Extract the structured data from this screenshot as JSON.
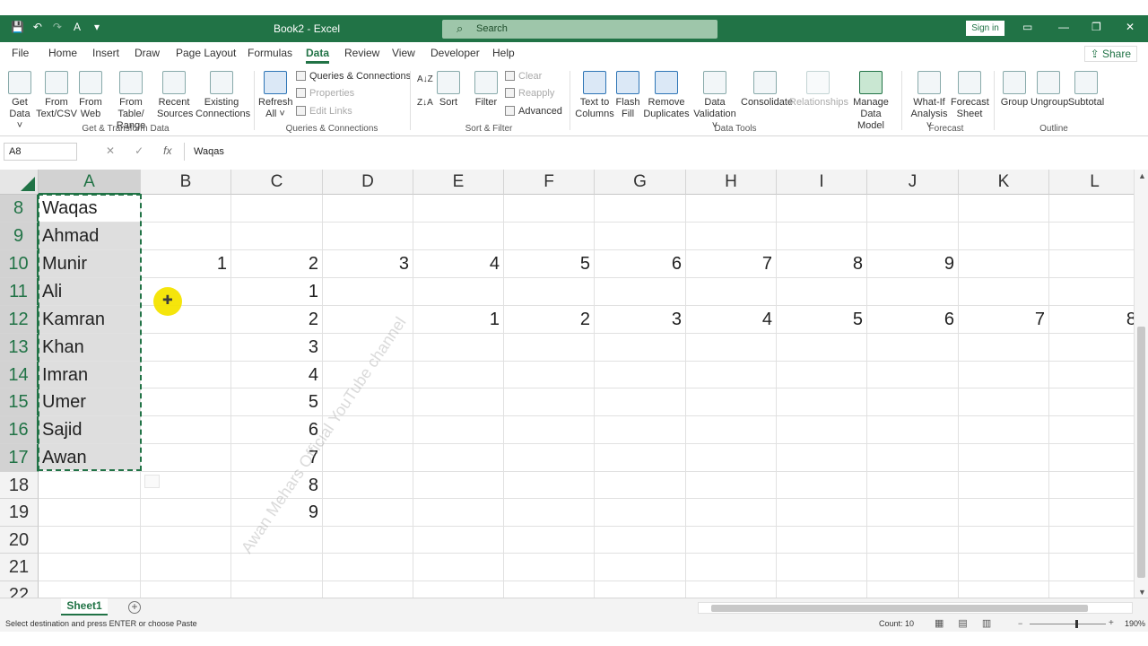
{
  "window": {
    "title": "Book2 - Excel",
    "search_placeholder": "Search",
    "sign_in": "Sign in",
    "minimize": "—",
    "restore": "❐",
    "close": "✕",
    "ribbon_display": "▭"
  },
  "qat": {
    "save": "💾",
    "undo": "↶",
    "redo": "↷",
    "format": "A",
    "more": "▾"
  },
  "menu": {
    "tabs": [
      "File",
      "Home",
      "Insert",
      "Draw",
      "Page Layout",
      "Formulas",
      "Data",
      "Review",
      "View",
      "Developer",
      "Help"
    ],
    "active": "Data",
    "share": "Share"
  },
  "ribbon": {
    "get_data": "Get Data ˅",
    "get_data_l1": "Get",
    "get_data_l2": "Data ˅",
    "from_text_l1": "From",
    "from_text_l2": "Text/CSV",
    "from_web_l1": "From",
    "from_web_l2": "Web",
    "from_table_l1": "From Table/",
    "from_table_l2": "Range",
    "recent_l1": "Recent",
    "recent_l2": "Sources",
    "existing_l1": "Existing",
    "existing_l2": "Connections",
    "group_get": "Get & Transform Data",
    "refresh_l1": "Refresh",
    "refresh_l2": "All ˅",
    "queries_connections": "Queries & Connections",
    "properties": "Properties",
    "edit_links": "Edit Links",
    "group_queries": "Queries & Connections",
    "sort_az": "A↓Z",
    "sort_za": "Z↓A",
    "sort": "Sort",
    "filter": "Filter",
    "clear": "Clear",
    "reapply": "Reapply",
    "advanced": "Advanced",
    "group_sort": "Sort & Filter",
    "text_to_cols_l1": "Text to",
    "text_to_cols_l2": "Columns",
    "flash_l1": "Flash",
    "flash_l2": "Fill",
    "remove_dup_l1": "Remove",
    "remove_dup_l2": "Duplicates",
    "validation_l1": "Data",
    "validation_l2": "Validation ˅",
    "consolidate": "Consolidate",
    "relationships": "Relationships",
    "manage_l1": "Manage",
    "manage_l2": "Data Model",
    "group_tools": "Data Tools",
    "whatif_l1": "What-If",
    "whatif_l2": "Analysis ˅",
    "forecast_l1": "Forecast",
    "forecast_l2": "Sheet",
    "group_forecast": "Forecast",
    "group_btn": "Group",
    "ungroup_btn": "Ungroup",
    "subtotal_btn": "Subtotal",
    "group_outline": "Outline"
  },
  "formula_bar": {
    "name_box": "A8",
    "cancel": "✕",
    "enter": "✓",
    "fx": "fx",
    "content": "Waqas"
  },
  "columns": [
    "A",
    "B",
    "C",
    "D",
    "E",
    "F",
    "G",
    "H",
    "I",
    "J",
    "K",
    "L"
  ],
  "rows": [
    "8",
    "9",
    "10",
    "11",
    "12",
    "13",
    "14",
    "15",
    "16",
    "17",
    "18",
    "19",
    "20",
    "21",
    "22"
  ],
  "cells": {
    "A8": "Waqas",
    "A9": "Ahmad",
    "A10": "Munir",
    "A11": "Ali",
    "A12": "Kamran",
    "A13": "Khan",
    "A14": "Imran",
    "A15": "Umer",
    "A16": "Sajid",
    "A17": "Awan",
    "B10": "1",
    "C10": "2",
    "D10": "3",
    "E10": "4",
    "F10": "5",
    "G10": "6",
    "H10": "7",
    "I10": "8",
    "J10": "9",
    "C11": "1",
    "C12": "2",
    "C13": "3",
    "C14": "4",
    "C15": "5",
    "C16": "6",
    "C17": "7",
    "C18": "8",
    "C19": "9",
    "E12": "1",
    "F12": "2",
    "G12": "3",
    "H12": "4",
    "I12": "5",
    "J12": "6",
    "K12": "7",
    "L12": "8"
  },
  "watermark": "Awan Mehars Official YouTube channel",
  "sheet": {
    "tab": "Sheet1",
    "add": "+"
  },
  "status": {
    "message": "Select destination and press ENTER or choose Paste",
    "count": "Count: 10",
    "zoom": "190%",
    "zoom_minus": "−",
    "zoom_plus": "+"
  }
}
